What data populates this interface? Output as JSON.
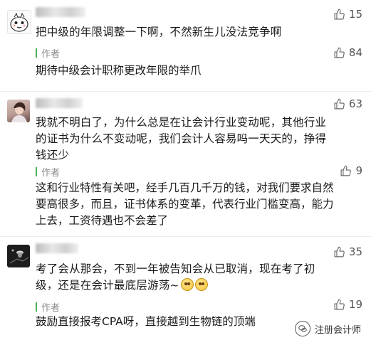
{
  "comments": [
    {
      "likes": "15",
      "text": "把中级的年限调整一下啊，不然新生儿没法竞争啊",
      "reply": {
        "author_label": "作者",
        "likes": "84",
        "text": "期待中级会计职称更改年限的举爪"
      }
    },
    {
      "likes": "63",
      "text": "我就不明白了，为什么总是在让会计行业变动呢，其他行业的证书为什么不变动呢，我们会计人容易吗一天天的，挣得钱还少",
      "reply": {
        "author_label": "作者",
        "likes": "9",
        "text": "这和行业特性有关吧，经手几百几千万的钱，对我们要求自然要高很多，而且，证书体系的变革，代表行业门槛变高，能力上去，工资待遇也不会差了"
      }
    },
    {
      "likes": "35",
      "text": "考了会从那会，不到一年被告知会从已取消，现在考了初级，还是在会计最底层游荡~",
      "reply": {
        "author_label": "作者",
        "likes": "19",
        "text": "鼓励直接报考CPA呀，直接越到生物链的顶端"
      }
    }
  ],
  "watermark": {
    "label": "注册会计师"
  },
  "colors": {
    "author_bar": "#4bb05a",
    "text": "#1a1a1a",
    "muted": "#8a8a8a"
  }
}
